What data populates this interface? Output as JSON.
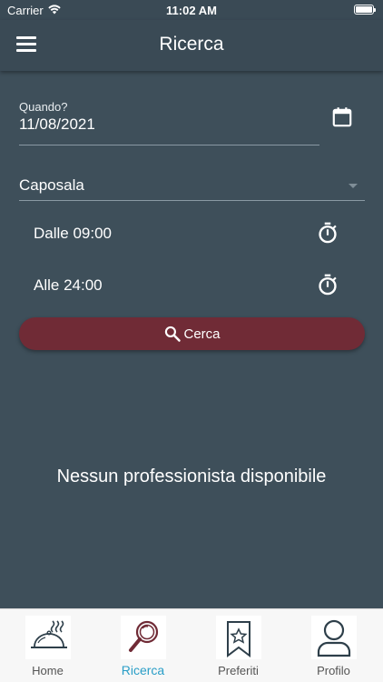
{
  "status_bar": {
    "carrier": "Carrier",
    "time": "11:02 AM"
  },
  "app_bar": {
    "title": "Ricerca",
    "menu_icon": "hamburger-menu-icon"
  },
  "form": {
    "date_label": "Quando?",
    "date_value": "11/08/2021",
    "calendar_icon": "calendar-icon",
    "role_value": "Caposala",
    "from_text": "Dalle  09:00",
    "to_text": "Alle  24:00",
    "timer_icon": "stopwatch-icon",
    "search_label": "Cerca",
    "search_icon": "search-icon"
  },
  "empty_message": "Nessun professionista disponibile",
  "bottom_nav": {
    "items": [
      {
        "label": "Home",
        "icon": "cloche-icon",
        "active": false
      },
      {
        "label": "Ricerca",
        "icon": "magnifier-icon",
        "active": true
      },
      {
        "label": "Preferiti",
        "icon": "bookmark-star-icon",
        "active": false
      },
      {
        "label": "Profilo",
        "icon": "user-icon",
        "active": false
      }
    ]
  },
  "colors": {
    "background": "#3e4f5a",
    "app_bar": "#3a4a55",
    "primary_button": "#702b36",
    "active_nav": "#2a9ec7",
    "nav_icon_accent": "#702b36",
    "nav_icon_dark": "#2e3f4a"
  }
}
